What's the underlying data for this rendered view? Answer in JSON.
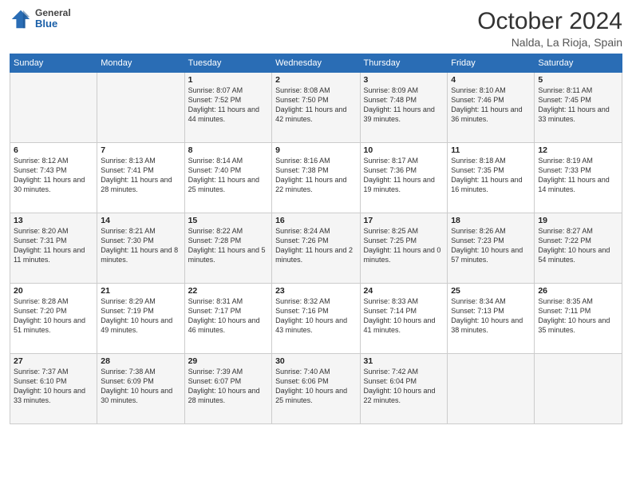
{
  "header": {
    "logo": {
      "general": "General",
      "blue": "Blue"
    },
    "title": "October 2024",
    "subtitle": "Nalda, La Rioja, Spain"
  },
  "calendar": {
    "days_of_week": [
      "Sunday",
      "Monday",
      "Tuesday",
      "Wednesday",
      "Thursday",
      "Friday",
      "Saturday"
    ],
    "weeks": [
      [
        {
          "day": "",
          "sunrise": "",
          "sunset": "",
          "daylight": ""
        },
        {
          "day": "",
          "sunrise": "",
          "sunset": "",
          "daylight": ""
        },
        {
          "day": "1",
          "sunrise": "Sunrise: 8:07 AM",
          "sunset": "Sunset: 7:52 PM",
          "daylight": "Daylight: 11 hours and 44 minutes."
        },
        {
          "day": "2",
          "sunrise": "Sunrise: 8:08 AM",
          "sunset": "Sunset: 7:50 PM",
          "daylight": "Daylight: 11 hours and 42 minutes."
        },
        {
          "day": "3",
          "sunrise": "Sunrise: 8:09 AM",
          "sunset": "Sunset: 7:48 PM",
          "daylight": "Daylight: 11 hours and 39 minutes."
        },
        {
          "day": "4",
          "sunrise": "Sunrise: 8:10 AM",
          "sunset": "Sunset: 7:46 PM",
          "daylight": "Daylight: 11 hours and 36 minutes."
        },
        {
          "day": "5",
          "sunrise": "Sunrise: 8:11 AM",
          "sunset": "Sunset: 7:45 PM",
          "daylight": "Daylight: 11 hours and 33 minutes."
        }
      ],
      [
        {
          "day": "6",
          "sunrise": "Sunrise: 8:12 AM",
          "sunset": "Sunset: 7:43 PM",
          "daylight": "Daylight: 11 hours and 30 minutes."
        },
        {
          "day": "7",
          "sunrise": "Sunrise: 8:13 AM",
          "sunset": "Sunset: 7:41 PM",
          "daylight": "Daylight: 11 hours and 28 minutes."
        },
        {
          "day": "8",
          "sunrise": "Sunrise: 8:14 AM",
          "sunset": "Sunset: 7:40 PM",
          "daylight": "Daylight: 11 hours and 25 minutes."
        },
        {
          "day": "9",
          "sunrise": "Sunrise: 8:16 AM",
          "sunset": "Sunset: 7:38 PM",
          "daylight": "Daylight: 11 hours and 22 minutes."
        },
        {
          "day": "10",
          "sunrise": "Sunrise: 8:17 AM",
          "sunset": "Sunset: 7:36 PM",
          "daylight": "Daylight: 11 hours and 19 minutes."
        },
        {
          "day": "11",
          "sunrise": "Sunrise: 8:18 AM",
          "sunset": "Sunset: 7:35 PM",
          "daylight": "Daylight: 11 hours and 16 minutes."
        },
        {
          "day": "12",
          "sunrise": "Sunrise: 8:19 AM",
          "sunset": "Sunset: 7:33 PM",
          "daylight": "Daylight: 11 hours and 14 minutes."
        }
      ],
      [
        {
          "day": "13",
          "sunrise": "Sunrise: 8:20 AM",
          "sunset": "Sunset: 7:31 PM",
          "daylight": "Daylight: 11 hours and 11 minutes."
        },
        {
          "day": "14",
          "sunrise": "Sunrise: 8:21 AM",
          "sunset": "Sunset: 7:30 PM",
          "daylight": "Daylight: 11 hours and 8 minutes."
        },
        {
          "day": "15",
          "sunrise": "Sunrise: 8:22 AM",
          "sunset": "Sunset: 7:28 PM",
          "daylight": "Daylight: 11 hours and 5 minutes."
        },
        {
          "day": "16",
          "sunrise": "Sunrise: 8:24 AM",
          "sunset": "Sunset: 7:26 PM",
          "daylight": "Daylight: 11 hours and 2 minutes."
        },
        {
          "day": "17",
          "sunrise": "Sunrise: 8:25 AM",
          "sunset": "Sunset: 7:25 PM",
          "daylight": "Daylight: 11 hours and 0 minutes."
        },
        {
          "day": "18",
          "sunrise": "Sunrise: 8:26 AM",
          "sunset": "Sunset: 7:23 PM",
          "daylight": "Daylight: 10 hours and 57 minutes."
        },
        {
          "day": "19",
          "sunrise": "Sunrise: 8:27 AM",
          "sunset": "Sunset: 7:22 PM",
          "daylight": "Daylight: 10 hours and 54 minutes."
        }
      ],
      [
        {
          "day": "20",
          "sunrise": "Sunrise: 8:28 AM",
          "sunset": "Sunset: 7:20 PM",
          "daylight": "Daylight: 10 hours and 51 minutes."
        },
        {
          "day": "21",
          "sunrise": "Sunrise: 8:29 AM",
          "sunset": "Sunset: 7:19 PM",
          "daylight": "Daylight: 10 hours and 49 minutes."
        },
        {
          "day": "22",
          "sunrise": "Sunrise: 8:31 AM",
          "sunset": "Sunset: 7:17 PM",
          "daylight": "Daylight: 10 hours and 46 minutes."
        },
        {
          "day": "23",
          "sunrise": "Sunrise: 8:32 AM",
          "sunset": "Sunset: 7:16 PM",
          "daylight": "Daylight: 10 hours and 43 minutes."
        },
        {
          "day": "24",
          "sunrise": "Sunrise: 8:33 AM",
          "sunset": "Sunset: 7:14 PM",
          "daylight": "Daylight: 10 hours and 41 minutes."
        },
        {
          "day": "25",
          "sunrise": "Sunrise: 8:34 AM",
          "sunset": "Sunset: 7:13 PM",
          "daylight": "Daylight: 10 hours and 38 minutes."
        },
        {
          "day": "26",
          "sunrise": "Sunrise: 8:35 AM",
          "sunset": "Sunset: 7:11 PM",
          "daylight": "Daylight: 10 hours and 35 minutes."
        }
      ],
      [
        {
          "day": "27",
          "sunrise": "Sunrise: 7:37 AM",
          "sunset": "Sunset: 6:10 PM",
          "daylight": "Daylight: 10 hours and 33 minutes."
        },
        {
          "day": "28",
          "sunrise": "Sunrise: 7:38 AM",
          "sunset": "Sunset: 6:09 PM",
          "daylight": "Daylight: 10 hours and 30 minutes."
        },
        {
          "day": "29",
          "sunrise": "Sunrise: 7:39 AM",
          "sunset": "Sunset: 6:07 PM",
          "daylight": "Daylight: 10 hours and 28 minutes."
        },
        {
          "day": "30",
          "sunrise": "Sunrise: 7:40 AM",
          "sunset": "Sunset: 6:06 PM",
          "daylight": "Daylight: 10 hours and 25 minutes."
        },
        {
          "day": "31",
          "sunrise": "Sunrise: 7:42 AM",
          "sunset": "Sunset: 6:04 PM",
          "daylight": "Daylight: 10 hours and 22 minutes."
        },
        {
          "day": "",
          "sunrise": "",
          "sunset": "",
          "daylight": ""
        },
        {
          "day": "",
          "sunrise": "",
          "sunset": "",
          "daylight": ""
        }
      ]
    ]
  }
}
